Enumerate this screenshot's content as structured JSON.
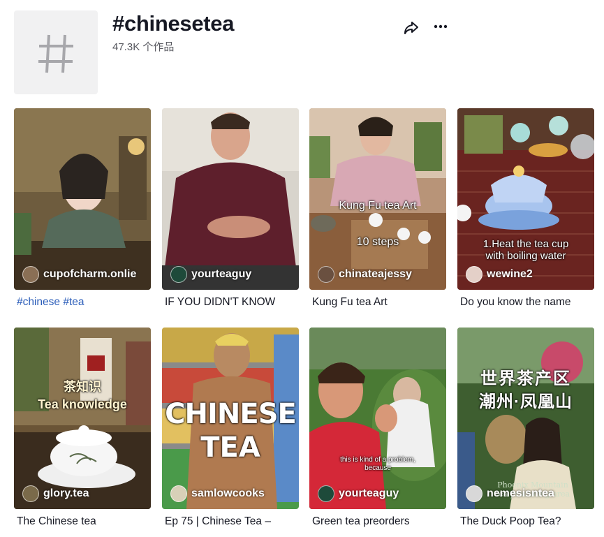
{
  "header": {
    "title": "#chinesetea",
    "subtitle": "47.3K 个作品"
  },
  "icons": {
    "hashtag": "hashtag-icon",
    "share": "share-icon",
    "more": "more-icon"
  },
  "videos": [
    {
      "author": "cupofcharm.onlie",
      "caption": "#chinese #tea",
      "overlay": []
    },
    {
      "author": "yourteaguy",
      "caption": "IF YOU DIDN'T KNOW",
      "overlay": []
    },
    {
      "author": "chinateajessy",
      "caption": "Kung Fu tea Art",
      "overlay": [
        "Kung Fu tea Art",
        "10 steps"
      ]
    },
    {
      "author": "wewine2",
      "caption": "Do you know the name",
      "overlay": [
        "1.Heat the tea cup",
        "with boiling water"
      ]
    },
    {
      "author": "glory.tea",
      "caption": "The Chinese tea",
      "overlay": [
        "茶知识",
        "Tea knowledge"
      ]
    },
    {
      "author": "samlowcooks",
      "caption": "Ep 75 | Chinese Tea –",
      "overlay": [
        "CHINESE",
        "TEA"
      ]
    },
    {
      "author": "yourteaguy",
      "caption": "Green tea preorders",
      "overlay": [
        "this is kind of a problem,",
        "because"
      ]
    },
    {
      "author": "nemesisntea",
      "caption": "The Duck Poop Tea?",
      "overlay": [
        "世界茶产区",
        "潮州·凤凰山",
        "Phoenix Mountain",
        "tea producing area"
      ]
    }
  ],
  "colors": {
    "text": "#161823",
    "secondary": "#57585f",
    "link": "#2b5db9",
    "placeholder": "#f1f1f2"
  }
}
